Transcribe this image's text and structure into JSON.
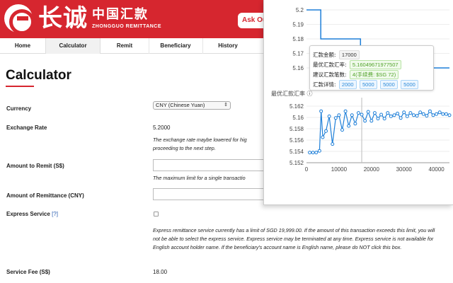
{
  "header": {
    "logo_cn": "长诚",
    "brand_cn": "中国汇款",
    "brand_en": "ZHONGGUO REMITTANCE",
    "ask_button": "Ask Ou",
    "brand_color": "#d6262f"
  },
  "nav": {
    "items": [
      "Home",
      "Calculator",
      "Remit",
      "Beneficiary",
      "History"
    ],
    "active": "Calculator"
  },
  "calculator": {
    "title": "Calculator",
    "currency_label": "Currency",
    "currency_value": "CNY (Chinese Yuan)",
    "rate_label": "Exchange Rate",
    "rate_value": "5.2000",
    "rate_note_1": "The exchange rate maybe lowered for hig",
    "rate_note_2": "proceeding to the next step.",
    "amount_label": "Amount to Remit (S$)",
    "amount_value": "",
    "amount_note": "The maximum limit for a single transactio",
    "remittance_label": "Amount of Remittance (CNY)",
    "remittance_value": "",
    "express_label": "Express Service",
    "express_help": "[?]",
    "express_checked": false,
    "express_note": "Express remittance service currently has a limit of SGD 19,999.00. If the amount of this transaction exceeds this limit, you will not be able to select the express service. Express service may be terminated at any time. Express service is not available for English account holder name. If the beneficiary's account name is English name, please do NOT click this box.",
    "fee_label": "Service Fee (S$)",
    "fee_value": "18.00"
  },
  "popup": {
    "chart1_y_ticks": [
      "5.2",
      "5.19",
      "5.18",
      "5.17",
      "5.16"
    ],
    "chart2_title": "最优汇款汇率",
    "tooltip": {
      "amount_label": "汇款金额:",
      "amount_value": "17000",
      "best_rate_label": "最优汇款汇率:",
      "best_rate_value": "5.16049671977507",
      "suggest_label": "建议汇款笔数:",
      "suggest_value": "4(手续费: $SG 72)",
      "detail_label": "汇款详情:",
      "details": [
        "2000",
        "5000",
        "5000",
        "5000"
      ]
    }
  },
  "chart_data": [
    {
      "type": "line",
      "y_ticks": [
        5.16,
        5.17,
        5.18,
        5.19,
        5.2
      ],
      "ylim": [
        5.16,
        5.2
      ],
      "xlim": [
        0,
        45000
      ],
      "x": [
        0,
        4500,
        4500,
        17000,
        17000,
        42000,
        42000,
        45000
      ],
      "y": [
        5.2,
        5.2,
        5.18,
        5.18,
        5.16,
        5.16,
        5.16,
        5.16
      ]
    },
    {
      "type": "line",
      "title": "最优汇款汇率",
      "x_ticks": [
        0,
        10000,
        20000,
        30000,
        40000
      ],
      "y_ticks": [
        5.152,
        5.154,
        5.156,
        5.158,
        5.16,
        5.162
      ],
      "xlim": [
        0,
        44000
      ],
      "ylim": [
        5.152,
        5.1625
      ],
      "x": [
        1000,
        2000,
        3000,
        4000,
        4500,
        5000,
        6000,
        7000,
        8000,
        9000,
        10000,
        11000,
        12000,
        13000,
        14000,
        15000,
        16000,
        17000,
        18000,
        19000,
        20000,
        21000,
        22000,
        23000,
        24000,
        25000,
        26000,
        27000,
        28000,
        29000,
        30000,
        31000,
        32000,
        33000,
        34000,
        35000,
        36000,
        37000,
        38000,
        39000,
        40000,
        41000,
        42000,
        43000,
        44000
      ],
      "y": [
        5.1538,
        5.1538,
        5.1538,
        5.1541,
        5.1611,
        5.1565,
        5.1576,
        5.1602,
        5.1553,
        5.1599,
        5.1604,
        5.1578,
        5.1611,
        5.1585,
        5.1604,
        5.1589,
        5.1608,
        5.1605,
        5.1594,
        5.161,
        5.1594,
        5.1608,
        5.1598,
        5.1605,
        5.1598,
        5.1608,
        5.1602,
        5.1604,
        5.1607,
        5.1599,
        5.1609,
        5.1602,
        5.1608,
        5.1604,
        5.1603,
        5.1609,
        5.1606,
        5.1603,
        5.1611,
        5.1604,
        5.1606,
        5.1609,
        5.1606,
        5.1606,
        5.1604
      ],
      "series_color": "#1e7fd8",
      "crosshair_x": 17000
    }
  ]
}
